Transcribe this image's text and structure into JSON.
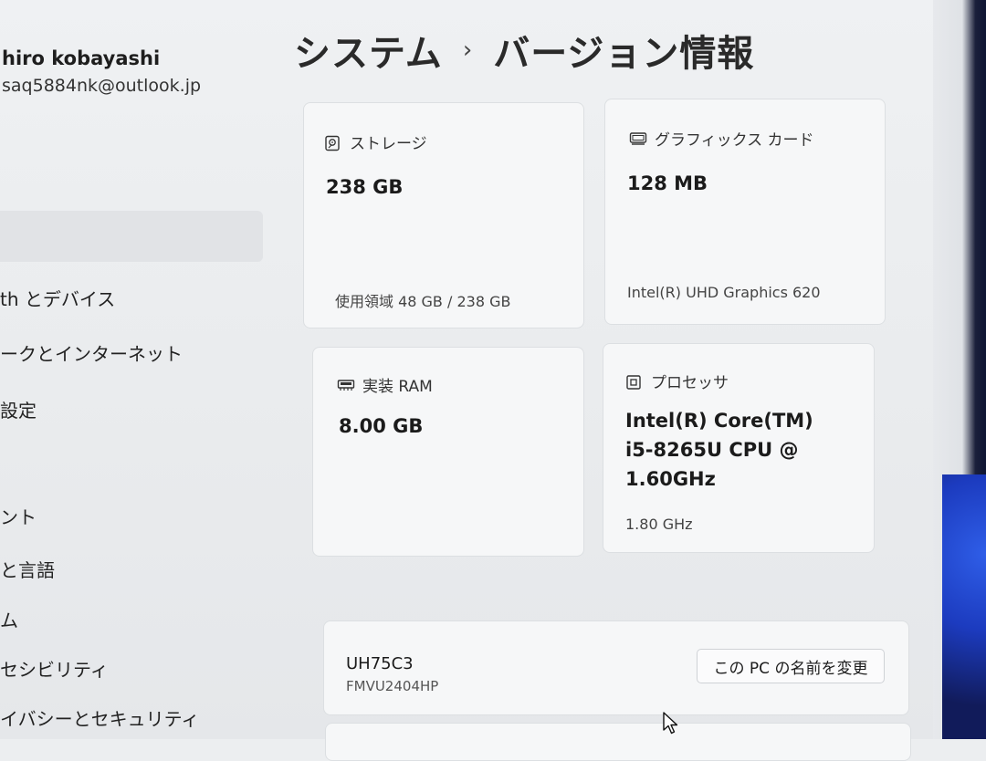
{
  "user": {
    "name": "hiro kobayashi",
    "email": "saq5884nk@outlook.jp"
  },
  "sidebar": {
    "items": [
      {
        "label": "th とデバイス"
      },
      {
        "label": "ークとインターネット"
      },
      {
        "label": "設定"
      },
      {
        "label": "ント"
      },
      {
        "label": "と言語"
      },
      {
        "label": "ム"
      },
      {
        "label": "セシビリティ"
      },
      {
        "label": "イバシーとセキュリティ"
      }
    ]
  },
  "header": {
    "breadcrumb_parent": "システム",
    "separator": "›",
    "title": "バージョン情報"
  },
  "specs": {
    "storage": {
      "label": "ストレージ",
      "value": "238 GB",
      "detail": "使用領域 48 GB / 238 GB",
      "icon": "hard-drive-icon"
    },
    "graphics": {
      "label": "グラフィックス カード",
      "value": "128 MB",
      "detail": "Intel(R) UHD Graphics 620",
      "icon": "display-adapter-icon"
    },
    "ram": {
      "label": "実装 RAM",
      "value": "8.00 GB",
      "icon": "memory-icon"
    },
    "processor": {
      "label": "プロセッサ",
      "value_lines": [
        "Intel(R) Core(TM)",
        "i5-8265U CPU @",
        "1.60GHz"
      ],
      "detail": "1.80 GHz",
      "icon": "processor-icon"
    }
  },
  "device": {
    "name": "UH75C3",
    "model": "FMVU2404HP",
    "rename_label": "この PC の名前を変更"
  }
}
